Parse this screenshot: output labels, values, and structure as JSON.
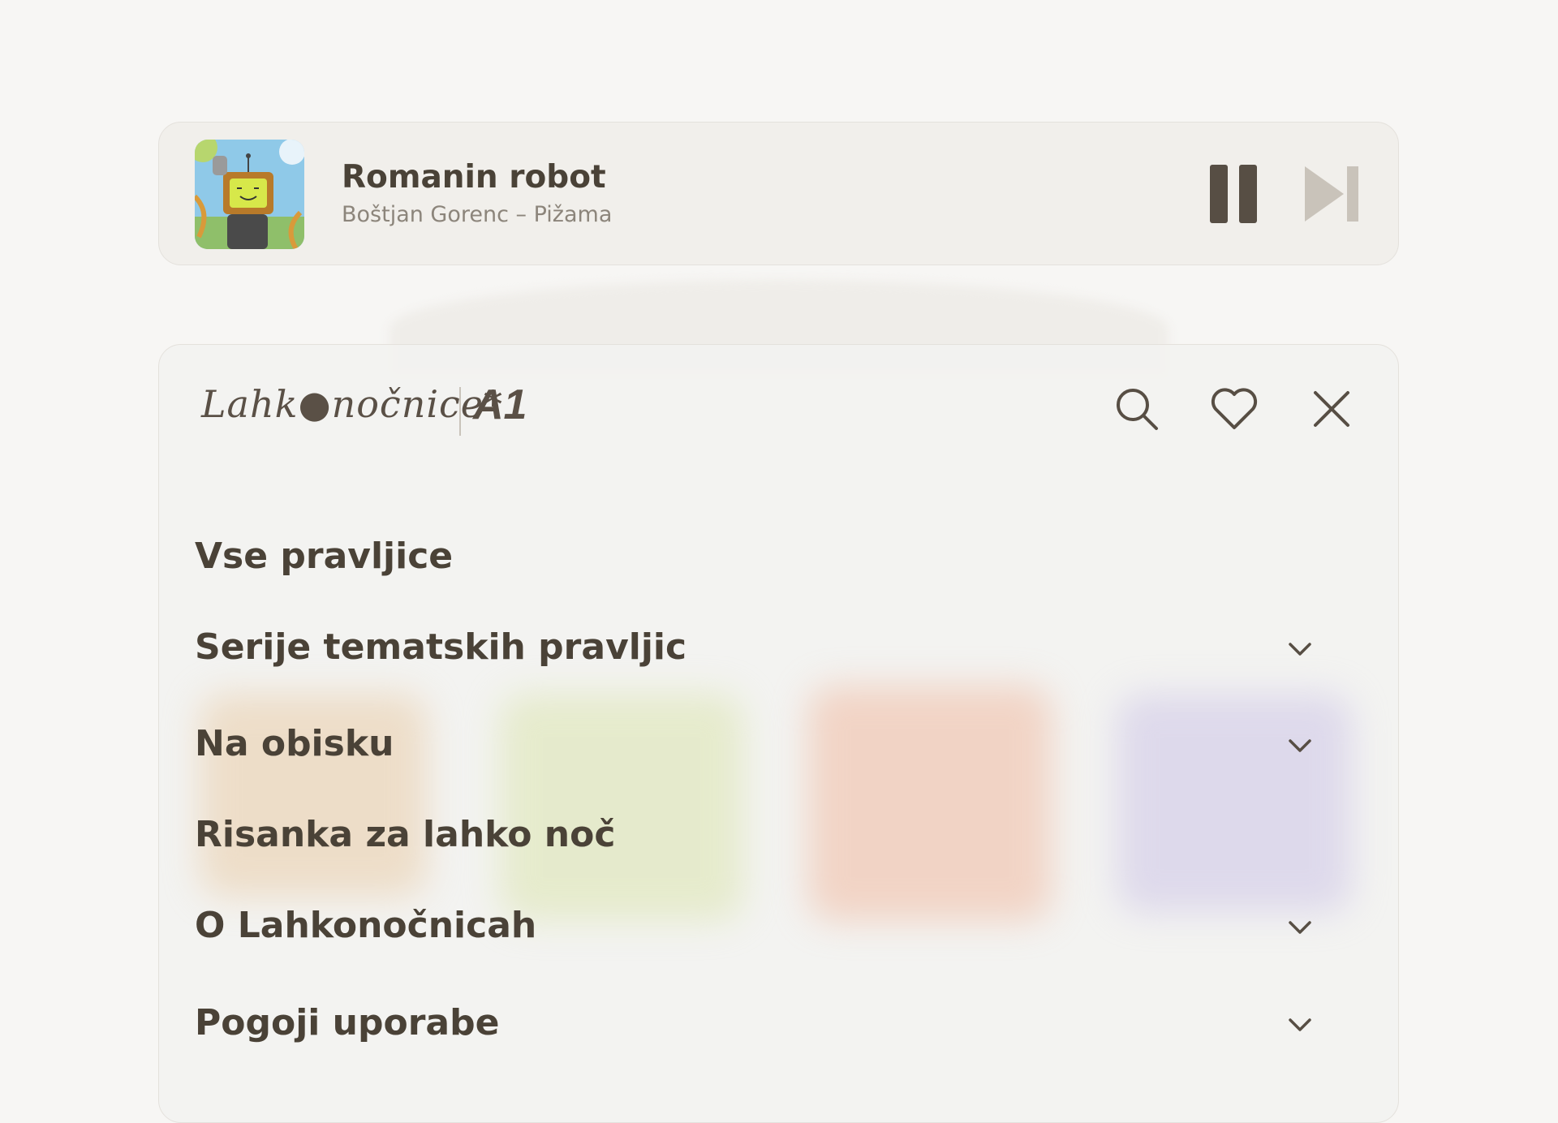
{
  "player": {
    "title": "Romanin robot",
    "subtitle": "Boštjan Gorenc – Pižama",
    "cover_icon": "robot-cover-art"
  },
  "header": {
    "logo_text": "Lahk●nočnice*",
    "brand": "A1"
  },
  "menu": {
    "items": [
      {
        "label": "Vse pravljice",
        "has_chevron": false
      },
      {
        "label": "Serije tematskih pravljic",
        "has_chevron": true
      },
      {
        "label": "Na obisku",
        "has_chevron": true
      },
      {
        "label": "Risanka za lahko noč",
        "has_chevron": false
      },
      {
        "label": "O Lahkonočnicah",
        "has_chevron": true
      },
      {
        "label": "Pogoji uporabe",
        "has_chevron": true
      }
    ]
  },
  "colors": {
    "text_dark": "#4a4237",
    "text_muted": "#8c857b",
    "panel_bg": "#f3f2f0",
    "player_bg": "#f1efeb",
    "next_button": "#c9c3ba"
  }
}
